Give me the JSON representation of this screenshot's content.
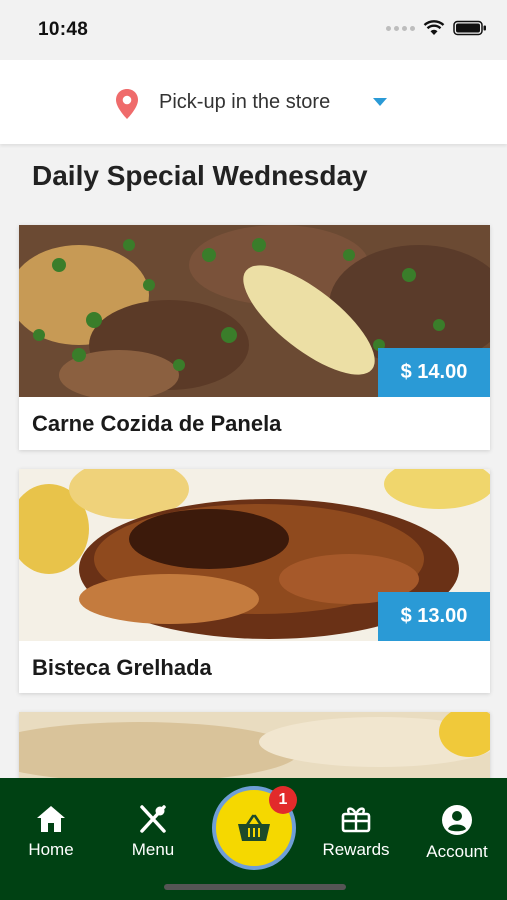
{
  "status_bar": {
    "time": "10:48",
    "icons": [
      "signal-icon",
      "wifi-icon",
      "battery-icon"
    ]
  },
  "location": {
    "label": "Pick-up in the store",
    "icon": "location-pin-icon"
  },
  "section": {
    "title": "Daily Special Wednesday"
  },
  "items": [
    {
      "name": "Carne Cozida de Panela",
      "price": "$ 14.00"
    },
    {
      "name": "Bisteca Grelhada",
      "price": "$ 13.00"
    },
    {
      "name": "",
      "price": ""
    }
  ],
  "nav": {
    "home": "Home",
    "menu": "Menu",
    "rewards": "Rewards",
    "account": "Account",
    "cart_badge": "1"
  },
  "colors": {
    "nav_background": "#004113",
    "price_tag": "#2a9ad6",
    "cart_button": "#f5d800",
    "badge": "#e22b2b",
    "pin": "#ef6b6b"
  }
}
